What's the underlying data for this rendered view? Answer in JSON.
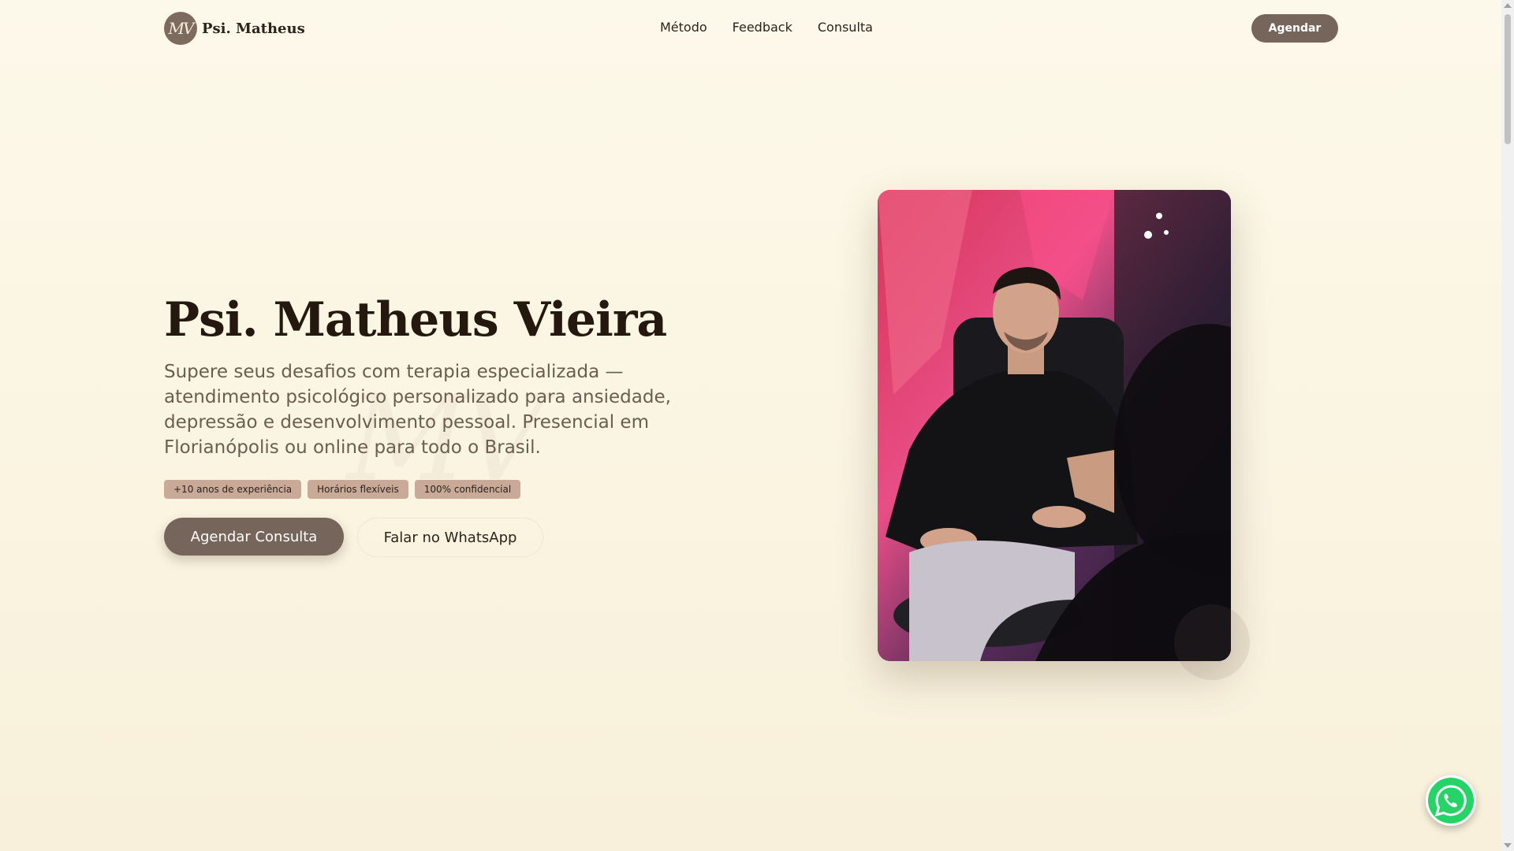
{
  "header": {
    "logo_mark": "MV",
    "logo_text": "Psi. Matheus",
    "nav": [
      {
        "label": "Método"
      },
      {
        "label": "Feedback"
      },
      {
        "label": "Consulta"
      }
    ],
    "cta_label": "Agendar"
  },
  "hero": {
    "watermark": "MV",
    "title": "Psi. Matheus Vieira",
    "subtitle": "Supere seus desafios com terapia especializada — atendimento psicológico personalizado para ansiedade, depressão e desenvolvimento pessoal. Presencial em Florianópolis ou online para todo o Brasil.",
    "tags": [
      "+10 anos de experiência",
      "Horários flexíveis",
      "100% confidencial"
    ],
    "primary_button": "Agendar Consulta",
    "secondary_button": "Falar no WhatsApp",
    "photo_alt": "Psi. Matheus Vieira"
  },
  "floating": {
    "icon": "whatsapp-icon"
  },
  "colors": {
    "background": "#fdf9ea",
    "accent": "#75655a",
    "tag": "#c9aa98",
    "whatsapp": "#25d366"
  }
}
